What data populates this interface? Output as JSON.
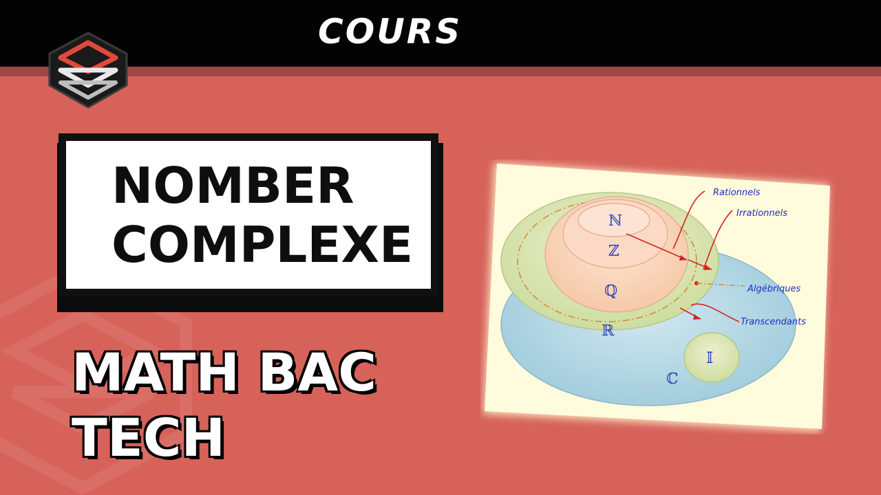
{
  "header": {
    "title": "COURS"
  },
  "title_box": {
    "line1": "NOMBER",
    "line2": "COMPLEXE"
  },
  "subtitle": {
    "line1": "MATH BAC",
    "line2": "TECH"
  },
  "diagram": {
    "sets": {
      "N": "ℕ",
      "Z": "ℤ",
      "Q": "ℚ",
      "R": "ℝ",
      "C": "ℂ",
      "I": "𝕀"
    },
    "labels": {
      "rationnels": "Rationnels",
      "irrationnels": "Irrationnels",
      "algebriques": "Algébriques",
      "transcendants": "Transcendants"
    }
  },
  "colors": {
    "background": "#d6625a",
    "topbar": "#030303",
    "label_blue": "#1c2fc4",
    "arrow_red": "#d4241f"
  }
}
